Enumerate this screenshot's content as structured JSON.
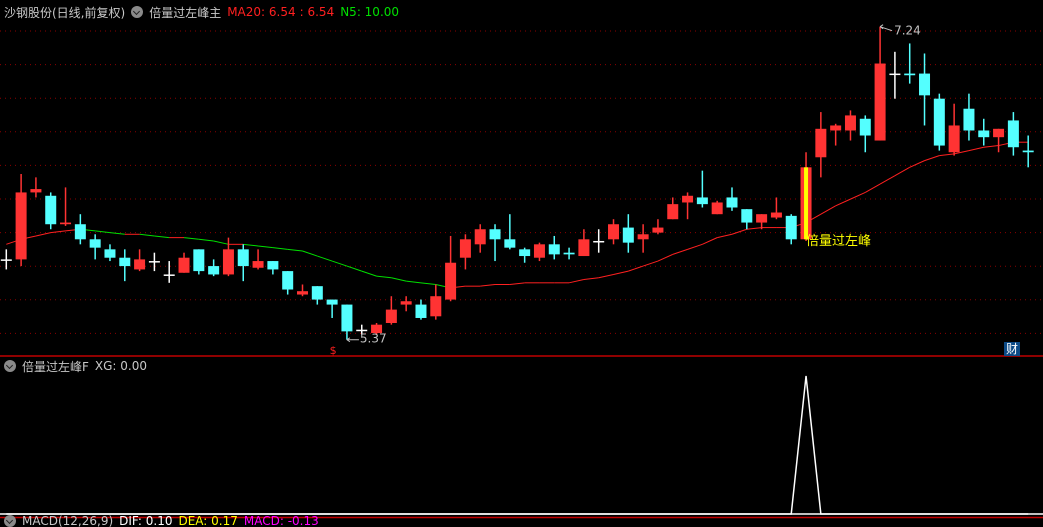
{
  "main_header": {
    "stock": "沙钢股份(日线,前复权)",
    "indicator": "倍量过左峰主",
    "ma20_label": "MA20: 6.54",
    "ma20_sep": ": 6.54",
    "n5_label": "N5: 10.00"
  },
  "sub_header": {
    "indicator": "倍量过左峰F",
    "xg_label": "XG: 0.00"
  },
  "macd_header": {
    "name": "MACD(12,26,9)",
    "dif": "DIF: 0.10",
    "dea": "DEA: 0.17",
    "macd": "MACD: -0.13"
  },
  "annotations": {
    "high_label": "7.24",
    "low_label": "5.37",
    "signal_label": "倍量过左峰",
    "event_marker": "$",
    "finance_badge": "财"
  },
  "colors": {
    "up": "#ff3333",
    "down": "#54ffff",
    "doji": "#ffffff",
    "ma_up": "#ff2020",
    "ma_down": "#00e000",
    "signal": "#ffff00",
    "grid": "#8b0000",
    "divider": "#c00000"
  },
  "chart_data": {
    "type": "candlestick",
    "title": "沙钢股份(日线,前复权)",
    "ylim": [
      5.28,
      7.4
    ],
    "signal_index": 54,
    "high": {
      "index": 59,
      "value": 7.24
    },
    "low": {
      "index": 23,
      "value": 5.37
    },
    "ohlc": [
      [
        5.85,
        5.91,
        5.79,
        5.85
      ],
      [
        5.85,
        6.36,
        5.81,
        6.25
      ],
      [
        6.25,
        6.34,
        6.22,
        6.27
      ],
      [
        6.23,
        6.25,
        6.03,
        6.06
      ],
      [
        6.06,
        6.28,
        6.05,
        6.07
      ],
      [
        6.06,
        6.12,
        5.94,
        5.97
      ],
      [
        5.97,
        6.0,
        5.85,
        5.92
      ],
      [
        5.91,
        5.94,
        5.84,
        5.86
      ],
      [
        5.86,
        5.91,
        5.72,
        5.81
      ],
      [
        5.79,
        5.91,
        5.78,
        5.85
      ],
      [
        5.84,
        5.89,
        5.78,
        5.84
      ],
      [
        5.76,
        5.84,
        5.71,
        5.76
      ],
      [
        5.77,
        5.89,
        5.77,
        5.86
      ],
      [
        5.91,
        5.91,
        5.76,
        5.78
      ],
      [
        5.81,
        5.85,
        5.75,
        5.76
      ],
      [
        5.76,
        5.98,
        5.75,
        5.91
      ],
      [
        5.91,
        5.94,
        5.72,
        5.81
      ],
      [
        5.8,
        5.91,
        5.79,
        5.84
      ],
      [
        5.84,
        5.84,
        5.76,
        5.79
      ],
      [
        5.78,
        5.78,
        5.64,
        5.67
      ],
      [
        5.64,
        5.7,
        5.63,
        5.66
      ],
      [
        5.69,
        5.69,
        5.58,
        5.61
      ],
      [
        5.61,
        5.61,
        5.5,
        5.58
      ],
      [
        5.58,
        5.58,
        5.37,
        5.42
      ],
      [
        5.43,
        5.46,
        5.4,
        5.43
      ],
      [
        5.41,
        5.47,
        5.4,
        5.46
      ],
      [
        5.47,
        5.63,
        5.46,
        5.55
      ],
      [
        5.58,
        5.63,
        5.54,
        5.6
      ],
      [
        5.58,
        5.61,
        5.49,
        5.5
      ],
      [
        5.51,
        5.7,
        5.49,
        5.63
      ],
      [
        5.61,
        5.99,
        5.6,
        5.83
      ],
      [
        5.86,
        6.0,
        5.79,
        5.97
      ],
      [
        5.94,
        6.06,
        5.89,
        6.03
      ],
      [
        6.03,
        6.06,
        5.84,
        5.97
      ],
      [
        5.97,
        6.12,
        5.91,
        5.92
      ],
      [
        5.91,
        5.92,
        5.83,
        5.87
      ],
      [
        5.86,
        5.95,
        5.84,
        5.94
      ],
      [
        5.94,
        5.99,
        5.85,
        5.88
      ],
      [
        5.89,
        5.92,
        5.85,
        5.88
      ],
      [
        5.87,
        6.03,
        5.87,
        5.97
      ],
      [
        5.96,
        6.03,
        5.89,
        5.96
      ],
      [
        5.97,
        6.09,
        5.94,
        6.06
      ],
      [
        6.04,
        6.12,
        5.89,
        5.95
      ],
      [
        5.97,
        6.06,
        5.89,
        6.0
      ],
      [
        6.01,
        6.09,
        6.0,
        6.04
      ],
      [
        6.09,
        6.22,
        6.09,
        6.18
      ],
      [
        6.19,
        6.25,
        6.09,
        6.23
      ],
      [
        6.22,
        6.38,
        6.16,
        6.18
      ],
      [
        6.12,
        6.2,
        6.12,
        6.19
      ],
      [
        6.22,
        6.28,
        6.14,
        6.16
      ],
      [
        6.15,
        6.15,
        6.03,
        6.07
      ],
      [
        6.07,
        6.12,
        6.03,
        6.12
      ],
      [
        6.1,
        6.22,
        6.09,
        6.13
      ],
      [
        6.11,
        6.12,
        5.94,
        5.97
      ],
      [
        5.97,
        6.49,
        5.96,
        6.4
      ],
      [
        6.46,
        6.73,
        6.34,
        6.63
      ],
      [
        6.62,
        6.66,
        6.53,
        6.65
      ],
      [
        6.62,
        6.74,
        6.56,
        6.71
      ],
      [
        6.69,
        6.71,
        6.49,
        6.59
      ],
      [
        6.56,
        7.24,
        6.56,
        7.02
      ],
      [
        6.96,
        7.09,
        6.81,
        6.96
      ],
      [
        6.96,
        7.14,
        6.9,
        6.95
      ],
      [
        6.96,
        7.08,
        6.65,
        6.83
      ],
      [
        6.81,
        6.84,
        6.5,
        6.53
      ],
      [
        6.49,
        6.78,
        6.47,
        6.65
      ],
      [
        6.75,
        6.84,
        6.56,
        6.62
      ],
      [
        6.62,
        6.69,
        6.53,
        6.58
      ],
      [
        6.58,
        6.63,
        6.49,
        6.63
      ],
      [
        6.68,
        6.73,
        6.47,
        6.52
      ],
      [
        6.5,
        6.59,
        6.4,
        6.49
      ]
    ],
    "ma20": [
      5.94,
      5.97,
      5.99,
      6.01,
      6.02,
      6.03,
      6.02,
      6.01,
      6.0,
      6.0,
      5.99,
      5.98,
      5.98,
      5.97,
      5.96,
      5.94,
      5.94,
      5.93,
      5.92,
      5.91,
      5.9,
      5.87,
      5.84,
      5.81,
      5.78,
      5.75,
      5.74,
      5.72,
      5.71,
      5.7,
      5.68,
      5.69,
      5.69,
      5.7,
      5.7,
      5.71,
      5.71,
      5.71,
      5.71,
      5.73,
      5.74,
      5.76,
      5.78,
      5.81,
      5.84,
      5.88,
      5.91,
      5.94,
      5.98,
      6.0,
      6.03,
      6.04,
      6.04,
      6.04,
      6.07,
      6.12,
      6.17,
      6.21,
      6.25,
      6.3,
      6.35,
      6.4,
      6.44,
      6.47,
      6.48,
      6.5,
      6.52,
      6.53,
      6.55,
      6.55
    ],
    "xg": {
      "ylim": [
        0,
        1.1
      ],
      "values_nonzero": {
        "54": 1
      }
    }
  }
}
